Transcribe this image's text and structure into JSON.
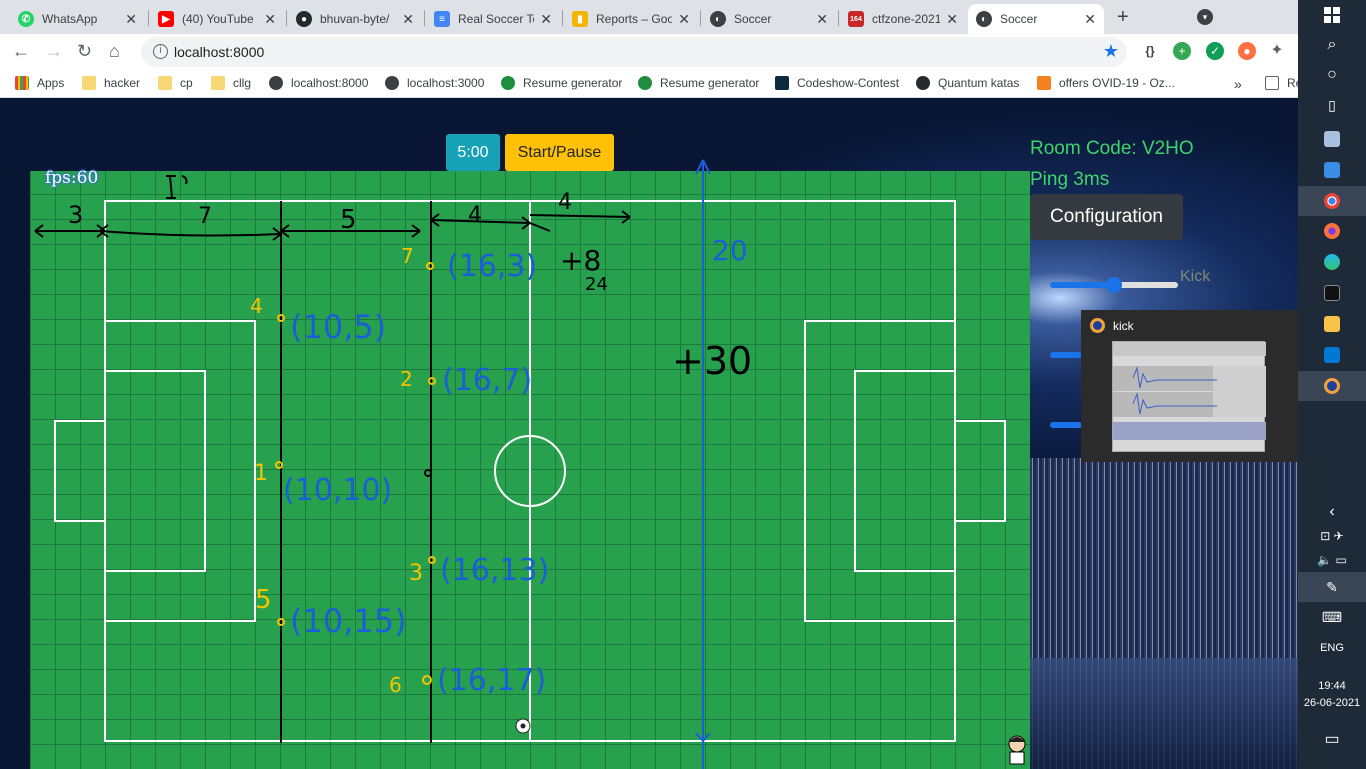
{
  "browser": {
    "tabs": [
      {
        "label": "WhatsApp",
        "icon": "whatsapp-icon",
        "color": "#25d366"
      },
      {
        "label": "(40) YouTube",
        "icon": "youtube-icon",
        "color": "#ff0000"
      },
      {
        "label": "bhuvan-byte/",
        "icon": "github-icon",
        "color": "#24292e"
      },
      {
        "label": "Real Soccer To",
        "icon": "docs-icon",
        "color": "#4285f4"
      },
      {
        "label": "Reports – Goo",
        "icon": "analytics-icon",
        "color": "#f4b400"
      },
      {
        "label": "Soccer",
        "icon": "globe-icon",
        "color": "#3c4043"
      },
      {
        "label": "ctfzone-2021",
        "icon": "ctf-icon",
        "color": "#c62828",
        "badge": "164"
      },
      {
        "label": "Soccer",
        "icon": "globe-icon",
        "color": "#3c4043",
        "active": true
      }
    ],
    "new_tab": "+",
    "url": "localhost:8000",
    "bookmarks": [
      {
        "label": "Apps",
        "icon": "apps-grid-icon"
      },
      {
        "label": "hacker",
        "icon": "folder-icon"
      },
      {
        "label": "cp",
        "icon": "folder-icon"
      },
      {
        "label": "cllg",
        "icon": "folder-icon"
      },
      {
        "label": "localhost:8000",
        "icon": "globe-icon"
      },
      {
        "label": "localhost:3000",
        "icon": "globe-icon"
      },
      {
        "label": "Resume generator",
        "icon": "resume-icon"
      },
      {
        "label": "Resume generator",
        "icon": "resume-icon"
      },
      {
        "label": "Codeshow-Contest",
        "icon": "code-icon"
      },
      {
        "label": "Quantum katas",
        "icon": "github-icon"
      },
      {
        "label": "offers OVID-19 - Oz...",
        "icon": "oz-icon"
      }
    ],
    "bookmarks_more": "»",
    "reading_list": "Re"
  },
  "game": {
    "timer": "5:00",
    "start_pause": "Start/Pause",
    "fps": "fps:60",
    "room_code": "Room Code: V2HO",
    "ping": "Ping 3ms",
    "configuration": "Configuration",
    "kick_label": "Kick",
    "kick_slider_fraction": 0.5
  },
  "annotations": {
    "dims": [
      "3",
      "7",
      "5",
      "4",
      "4"
    ],
    "top_small": "1",
    "extra": [
      "+8",
      "24",
      "20",
      "+30"
    ],
    "players": [
      {
        "num": "7",
        "coord": "(16,3)"
      },
      {
        "num": "4",
        "coord": "(10,5)"
      },
      {
        "num": "2",
        "coord": "(16,7)"
      },
      {
        "num": "1",
        "coord": "(10,10)"
      },
      {
        "num": "3",
        "coord": "(16,13)"
      },
      {
        "num": "5",
        "coord": "(10,15)"
      },
      {
        "num": "6",
        "coord": "(16,17)"
      }
    ]
  },
  "preview": {
    "title": "kick"
  },
  "taskbar": {
    "time": "19:44",
    "date": "26-06-2021",
    "lang": "ENG"
  }
}
